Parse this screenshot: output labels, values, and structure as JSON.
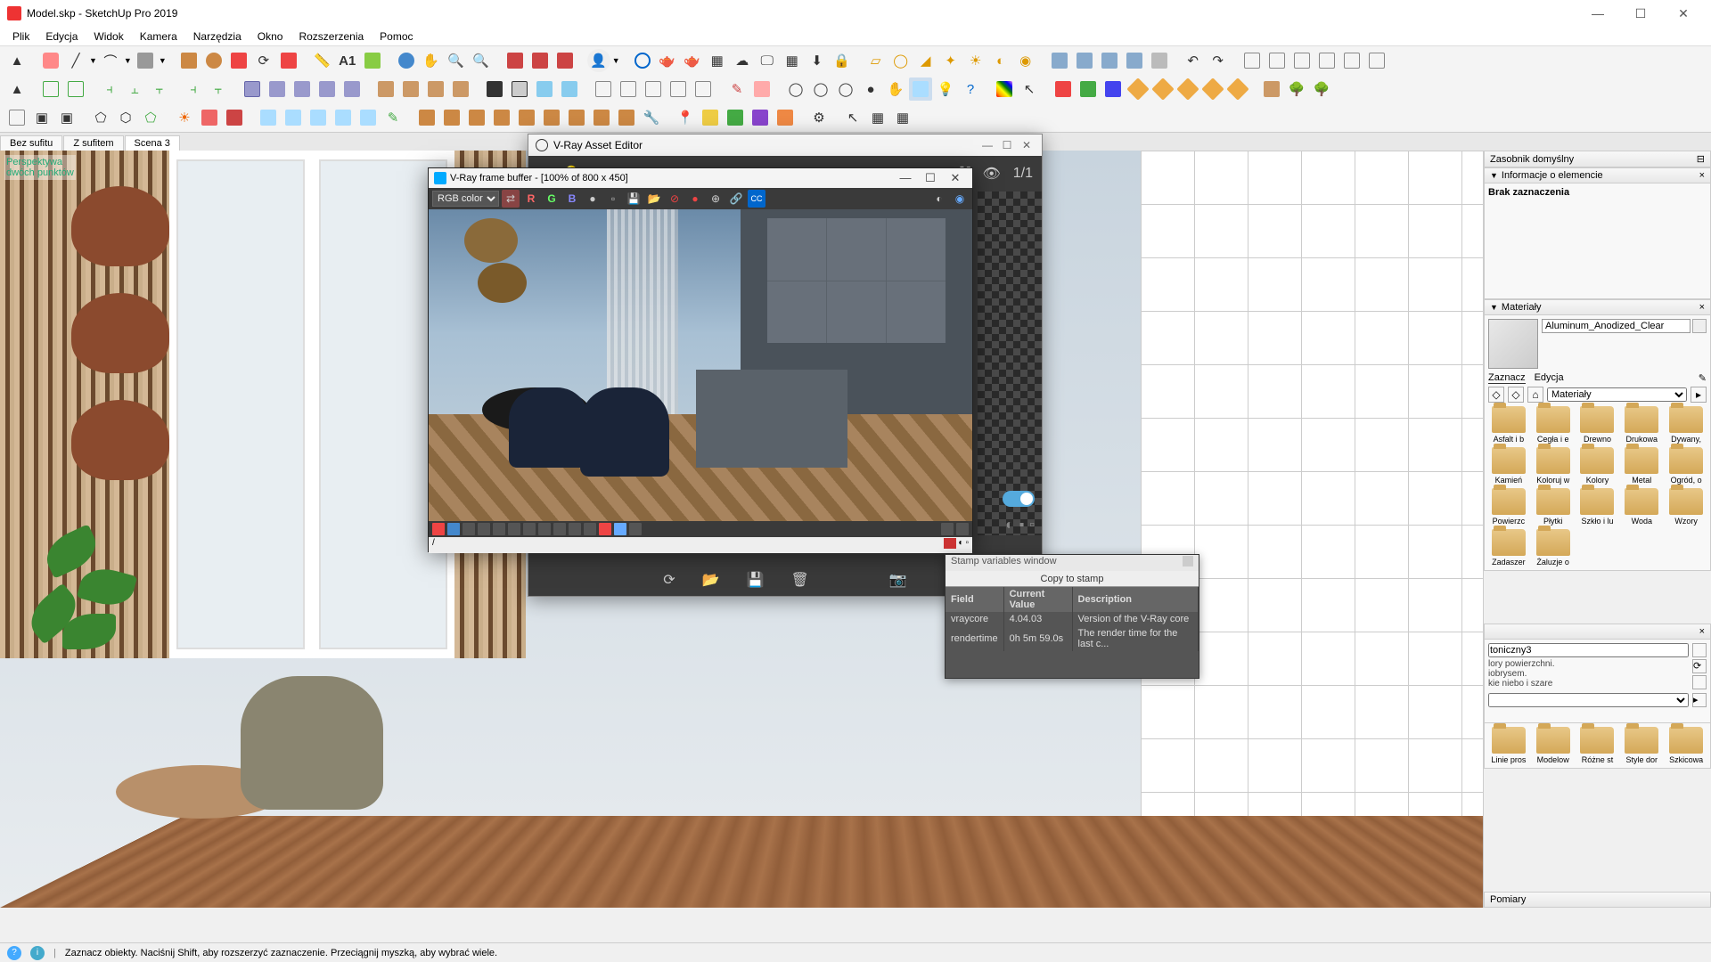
{
  "app": {
    "title": "Model.skp - SketchUp Pro 2019"
  },
  "winbtns": {
    "min": "—",
    "max": "☐",
    "close": "✕"
  },
  "menu": [
    "Plik",
    "Edycja",
    "Widok",
    "Kamera",
    "Narzędzia",
    "Okno",
    "Rozszerzenia",
    "Pomoc"
  ],
  "scene_tabs": [
    "Bez sufitu",
    "Z sufitem",
    "Scena 3"
  ],
  "perspective_label": "Perspektywa\ndwóch punktów",
  "tray": {
    "title": "Zasobnik domyślny",
    "info_header": "Informacje o elemencie",
    "info_body": "Brak zaznaczenia",
    "materials_header": "Materiały",
    "material_name": "Aluminum_Anodized_Clear",
    "tabs": [
      "Zaznacz",
      "Edycja"
    ],
    "dropdown": "Materiały",
    "folders": [
      "Asfalt i b",
      "Cegła i e",
      "Drewno",
      "Drukowa",
      "Dywany,",
      "Kamień",
      "Koloruj w",
      "Kolory",
      "Metal",
      "Ogród, o",
      "Powierzc",
      "Płytki",
      "Szkło i lu",
      "Woda",
      "Wzory",
      "Zadaszer",
      "Żaluzje o"
    ],
    "folders2": [
      "Linie pros",
      "Modelow",
      "Różne st",
      "Style dor",
      "Szkicowa"
    ],
    "pomiary": "Pomiary"
  },
  "statusbar": {
    "text": "Zaznacz obiekty. Naciśnij Shift, aby rozszerzyć zaznaczenie. Przeciągnij myszką, aby wybrać wiele."
  },
  "vray_asset": {
    "title": "V-Ray Asset Editor",
    "ratio": "1/1"
  },
  "vfb": {
    "title": "V-Ray frame buffer - [100% of 800 x 450]",
    "channel": "RGB color",
    "rgb": [
      "R",
      "G",
      "B"
    ]
  },
  "stamp": {
    "title": "Stamp variables window",
    "copy": "Copy to stamp",
    "headers": [
      "Field",
      "Current Value",
      "Description"
    ],
    "rows": [
      {
        "f": "vraycore",
        "v": "4.04.03",
        "d": "Version of the V-Ray core"
      },
      {
        "f": "rendertime",
        "v": "0h  5m 59.0s",
        "d": "The render time for the last c..."
      }
    ]
  },
  "style_desc": {
    "name": "toniczny3",
    "line1": "lory powierzchni.",
    "line2": "iobrysem.",
    "line3": "kie niebo i szare"
  }
}
